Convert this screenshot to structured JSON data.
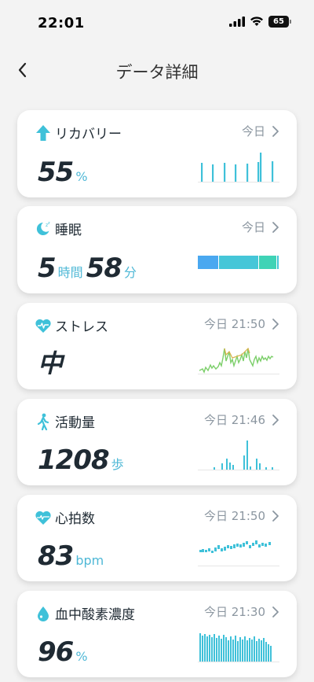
{
  "status": {
    "time": "22:01",
    "battery": "65"
  },
  "nav": {
    "title": "データ詳細"
  },
  "cards": [
    {
      "title": "リカバリー",
      "meta": "今日",
      "value": "55",
      "unit": "%"
    },
    {
      "title": "睡眠",
      "meta": "今日",
      "hours": "5",
      "hours_unit": "時間",
      "minutes": "58",
      "minutes_unit": "分"
    },
    {
      "title": "ストレス",
      "meta": "今日 21:50",
      "value": "中"
    },
    {
      "title": "活動量",
      "meta": "今日 21:46",
      "value": "1208",
      "unit": "歩"
    },
    {
      "title": "心拍数",
      "meta": "今日 21:50",
      "value": "83",
      "unit": "bpm"
    },
    {
      "title": "血中酸素濃度",
      "meta": "今日 21:30",
      "value": "96",
      "unit": "%"
    }
  ],
  "colors": {
    "accent": "#3fc1d9",
    "sleep_deep": "#4aa8f0",
    "sleep_light": "#45c6d8",
    "sleep_rem": "#3fd3b6"
  },
  "icons": [
    "back-chevron-icon",
    "arrow-up-icon",
    "moon-sleep-icon",
    "heart-wave-icon",
    "walking-person-icon",
    "heart-pulse-icon",
    "water-drop-icon",
    "chevron-right-icon"
  ]
}
